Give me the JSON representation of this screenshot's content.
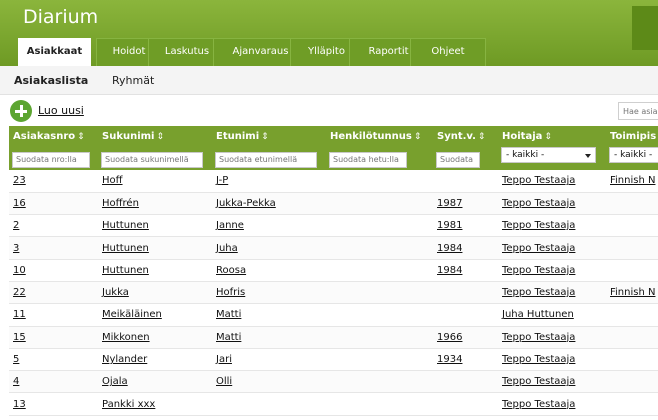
{
  "app_title": "Diarium",
  "tabs": [
    "Asiakkaat",
    "Hoidot",
    "Laskutus",
    "Ajanvaraus",
    "Ylläpito",
    "Raportit",
    "Ohjeet"
  ],
  "subnav": [
    "Asiakaslista",
    "Ryhmät"
  ],
  "new_button": "Luo uusi",
  "global_search_placeholder": "Hae asia",
  "columns": [
    "Asiakasnro",
    "Sukunimi",
    "Etunimi",
    "Henkilötunnus",
    "Synt.v.",
    "Hoitaja",
    "Toimipis"
  ],
  "filters": {
    "nro": "Suodata nro:lla",
    "sukunimi": "Suodata sukunimellä",
    "etunimi": "Suodata etunimellä",
    "hetu": "Suodata hetu:lla",
    "syntv": "Suodata",
    "hoitaja": "- kaikki -",
    "toimipiste": "- kaikki -"
  },
  "rows": [
    {
      "nro": "23",
      "sukunimi": "Hoff",
      "etunimi": "J-P",
      "hetu": "",
      "syntv": "",
      "hoitaja": "Teppo Testaaja",
      "toimipiste": "Finnish N"
    },
    {
      "nro": "16",
      "sukunimi": "Hoffrén",
      "etunimi": "Jukka-Pekka",
      "hetu": "",
      "syntv": "1987",
      "hoitaja": "Teppo Testaaja",
      "toimipiste": ""
    },
    {
      "nro": "2",
      "sukunimi": "Huttunen",
      "etunimi": "Janne",
      "hetu": "",
      "syntv": "1981",
      "hoitaja": "Teppo Testaaja",
      "toimipiste": ""
    },
    {
      "nro": "3",
      "sukunimi": "Huttunen",
      "etunimi": "Juha",
      "hetu": "",
      "syntv": "1984",
      "hoitaja": "Teppo Testaaja",
      "toimipiste": ""
    },
    {
      "nro": "10",
      "sukunimi": "Huttunen",
      "etunimi": "Roosa",
      "hetu": "",
      "syntv": "1984",
      "hoitaja": "Teppo Testaaja",
      "toimipiste": ""
    },
    {
      "nro": "22",
      "sukunimi": "Jukka",
      "etunimi": "Hofris",
      "hetu": "",
      "syntv": "",
      "hoitaja": "Teppo Testaaja",
      "toimipiste": "Finnish N"
    },
    {
      "nro": "11",
      "sukunimi": "Meikäläinen",
      "etunimi": "Matti",
      "hetu": "",
      "syntv": "",
      "hoitaja": "Juha Huttunen",
      "toimipiste": ""
    },
    {
      "nro": "15",
      "sukunimi": "Mikkonen",
      "etunimi": "Matti",
      "hetu": "",
      "syntv": "1966",
      "hoitaja": "Teppo Testaaja",
      "toimipiste": ""
    },
    {
      "nro": "5",
      "sukunimi": "Nylander",
      "etunimi": "Jari",
      "hetu": "",
      "syntv": "1934",
      "hoitaja": "Teppo Testaaja",
      "toimipiste": ""
    },
    {
      "nro": "4",
      "sukunimi": "Ojala",
      "etunimi": "Olli",
      "hetu": "",
      "syntv": "",
      "hoitaja": "Teppo Testaaja",
      "toimipiste": ""
    },
    {
      "nro": "13",
      "sukunimi": "Pankki xxx",
      "etunimi": "",
      "hetu": "",
      "syntv": "",
      "hoitaja": "Teppo Testaaja",
      "toimipiste": ""
    }
  ],
  "colors": {
    "brand_green": "#78a02d",
    "header_green": "#6e9a24",
    "plus_green": "#5ca531"
  },
  "icons": {
    "sort": "sort-icon",
    "new": "plus-circle-icon",
    "dropdown": "chevron-down-icon"
  }
}
